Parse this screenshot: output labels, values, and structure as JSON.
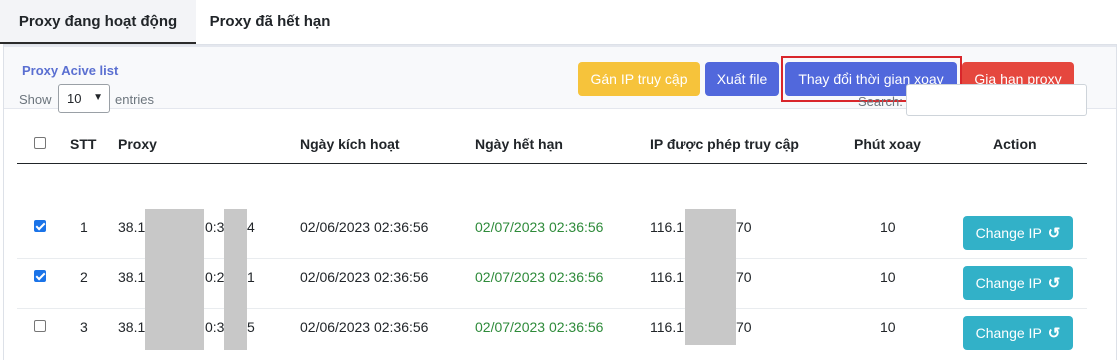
{
  "tabs": [
    {
      "label": "Proxy đang hoạt động",
      "active": true
    },
    {
      "label": "Proxy đã hết hạn",
      "active": false
    }
  ],
  "card": {
    "title": "Proxy Acive list",
    "buttons": {
      "allow_ip": "Gán IP truy cập",
      "export": "Xuất file",
      "change_rotation": "Thay đổi thời gian xoay",
      "extend": "Gia hạn proxy"
    }
  },
  "table_controls": {
    "show_label": "Show",
    "page_size": "10",
    "entries_label": "entries",
    "search_label": "Search:",
    "search_value": ""
  },
  "columns": [
    "STT",
    "Proxy",
    "Ngày kích hoạt",
    "Ngày hết hạn",
    "IP được phép truy cập",
    "Phút xoay",
    "Action"
  ],
  "rows": [
    {
      "checked": true,
      "stt": "1",
      "proxy_a": "38.1",
      "proxy_b": "0:3",
      "proxy_c": "4",
      "activated": "02/06/2023 02:36:56",
      "expires": "02/07/2023 02:36:56",
      "ip_a": "116.1",
      "ip_b": "70",
      "minutes": "10",
      "action": "Change IP"
    },
    {
      "checked": true,
      "stt": "2",
      "proxy_a": "38.1",
      "proxy_b": "0:2",
      "proxy_c": "1",
      "activated": "02/06/2023 02:36:56",
      "expires": "02/07/2023 02:36:56",
      "ip_a": "116.1",
      "ip_b": "70",
      "minutes": "10",
      "action": "Change IP"
    },
    {
      "checked": false,
      "stt": "3",
      "proxy_a": "38.1",
      "proxy_b": "0:3",
      "proxy_c": "5",
      "activated": "02/06/2023 02:36:56",
      "expires": "02/07/2023 02:36:56",
      "ip_a": "116.1",
      "ip_b": "70",
      "minutes": "10",
      "action": "Change IP"
    }
  ],
  "icons": {
    "refresh": "rotate-ccw-icon",
    "chevron": "chevron-down-icon"
  },
  "colors": {
    "accent": "#5168dc",
    "warning": "#f6c33b",
    "danger": "#e5473e",
    "info": "#32b1c8",
    "success_text": "#2e8b3a",
    "highlight_border": "#d9262b"
  }
}
